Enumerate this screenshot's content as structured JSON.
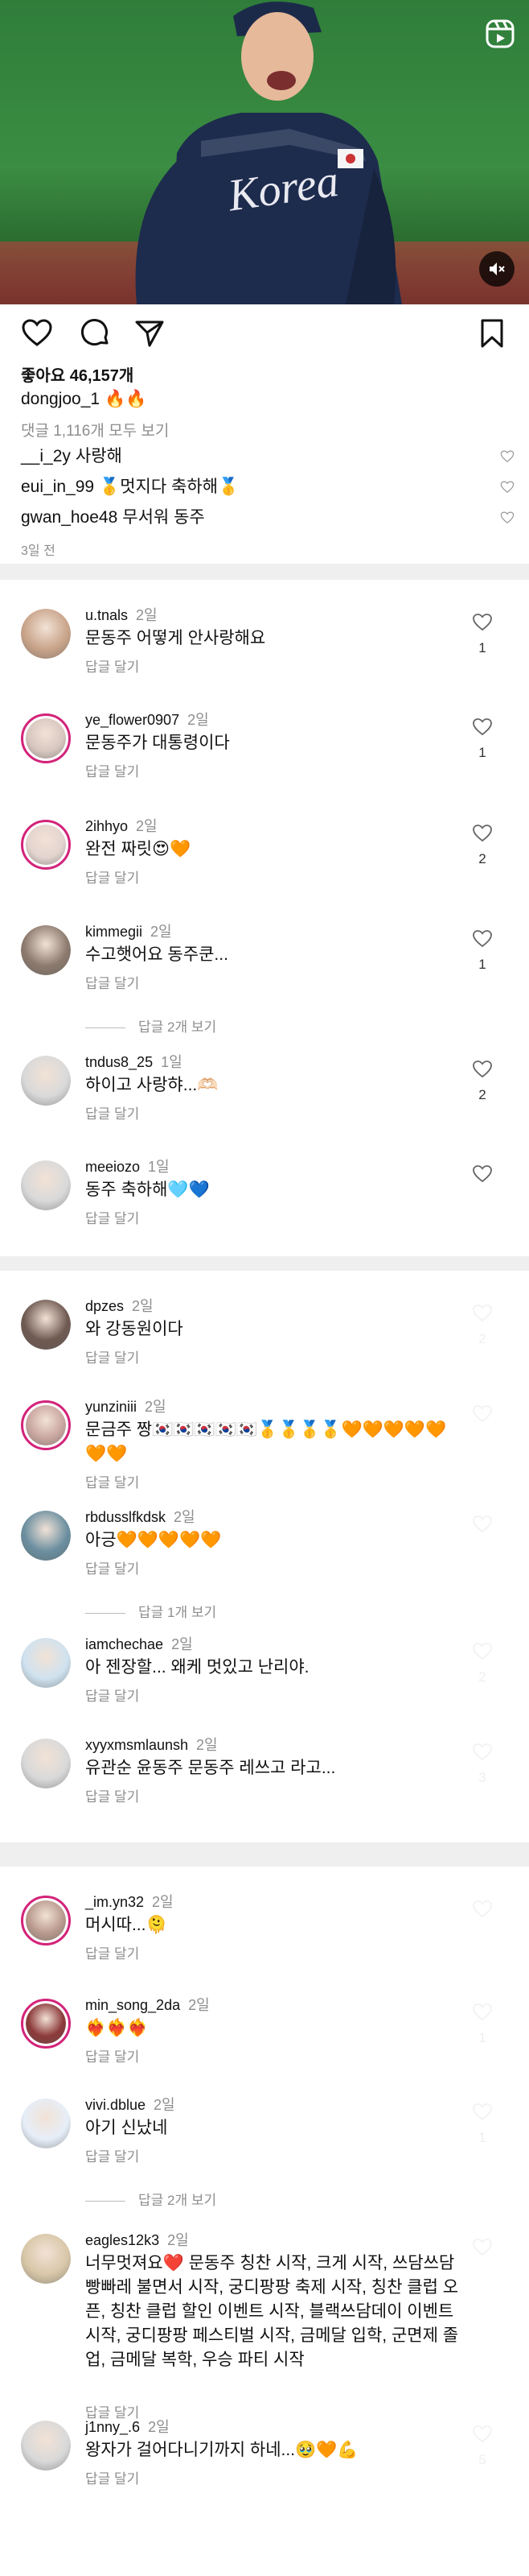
{
  "post": {
    "likes": "좋아요 46,157개",
    "caption_user": "dongjoo_1",
    "caption_text": "🔥🔥",
    "view_all": "댓글 1,116개 모두 보기",
    "preview_comments": [
      {
        "user": "__i_2y",
        "text": "사랑해"
      },
      {
        "user": "eui_in_99",
        "text": "🥇멋지다 축하해🥇"
      },
      {
        "user": "gwan_hoe48",
        "text": "무서워 동주"
      }
    ],
    "time_ago": "3일 전",
    "jersey_text": "Korea"
  },
  "reply_label": "답글 달기",
  "cards": [
    {
      "comments": [
        {
          "user": "u.tnals",
          "age": "2일",
          "text": "문동주 어떻게 안사랑해요",
          "likes": "1",
          "color": "#c9a48a"
        },
        {
          "user": "ye_flower0907",
          "age": "2일",
          "text": "문동주가 대통령이다",
          "likes": "1",
          "color": "#d8c7c0",
          "ring": true
        },
        {
          "user": "2ihhyo",
          "age": "2일",
          "text": "완전 짜릿😍🧡",
          "likes": "2",
          "color": "#e3d4cf",
          "ring": true
        },
        {
          "user": "kimmegii",
          "age": "2일",
          "text": "수고햇어요 동주쿤...",
          "likes": "1",
          "color": "#8c7a6e",
          "more": "답글 2개 보기"
        },
        {
          "user": "tndus8_25",
          "age": "1일",
          "text": "하이고 사랑햐...🫶🏻",
          "likes": "2",
          "color": "#d9d9d9"
        },
        {
          "user": "meeiozo",
          "age": "1일",
          "text": "동주 축하해🩵💙",
          "likes": "",
          "color": "#d9d9d9"
        }
      ]
    },
    {
      "comments": [
        {
          "user": "dpzes",
          "age": "2일",
          "text": "와 강동원이다",
          "likes": "2",
          "color": "#6f5a52"
        },
        {
          "user": "yunziniii",
          "age": "2일",
          "text": "문금주 짱🇰🇷🇰🇷🇰🇷🇰🇷🇰🇷🥇🥇🥇🥇🧡🧡🧡🧡🧡🧡🧡",
          "likes": "",
          "color": "#c9a6a0",
          "ring": true
        },
        {
          "user": "rbdusslfkdsk",
          "age": "2일",
          "text": "아긍🧡🧡🧡🧡🧡",
          "likes": "",
          "color": "#6b8fa0",
          "more": "답글 1개 보기"
        },
        {
          "user": "iamchechae",
          "age": "2일",
          "text": "아 젠장할... 왜케 멋있고 난리야.",
          "likes": "2",
          "color": "#cfe2ef"
        },
        {
          "user": "xyyxmsmlaunsh",
          "age": "2일",
          "text": "유관순 윤동주 문동주 레쓰고 라고...",
          "likes": "3",
          "color": "#d9d9d9"
        }
      ]
    },
    {
      "comments": [
        {
          "user": "_im.yn32",
          "age": "2일",
          "text": "머시따...🫠",
          "likes": "",
          "color": "#b99a8d",
          "ring": true
        },
        {
          "user": "min_song_2da",
          "age": "2일",
          "text": "❤️‍🔥❤️‍🔥❤️‍🔥",
          "likes": "1",
          "color": "#8c3a3a",
          "ring": true
        },
        {
          "user": "vivi.dblue",
          "age": "2일",
          "text": "아기 신났네",
          "likes": "1",
          "color": "#e6eef8",
          "more": "답글 2개 보기"
        },
        {
          "user": "eagles12k3",
          "age": "2일",
          "text": "너무멋져요❤️ 문동주 칭찬 시작, 크게 시작, 쓰담쓰담 빵빠레 불면서 시작, 궁디팡팡 축제 시작, 칭찬 클럽 오픈, 칭찬 클럽 할인 이벤트 시작, 블랙쓰담데이 이벤트 시작, 궁디팡팡 페스티벌 시작, 금메달 입학, 군면제 졸업, 금메달 복학, 우승 파티 시작",
          "likes": "",
          "color": "#d8c7a8"
        },
        {
          "user": "j1nny_.6",
          "age": "2일",
          "text": "왕자가 걸어다니기까지 하네...🥹🧡💪",
          "likes": "5",
          "color": "#d9d9d9"
        }
      ]
    }
  ]
}
